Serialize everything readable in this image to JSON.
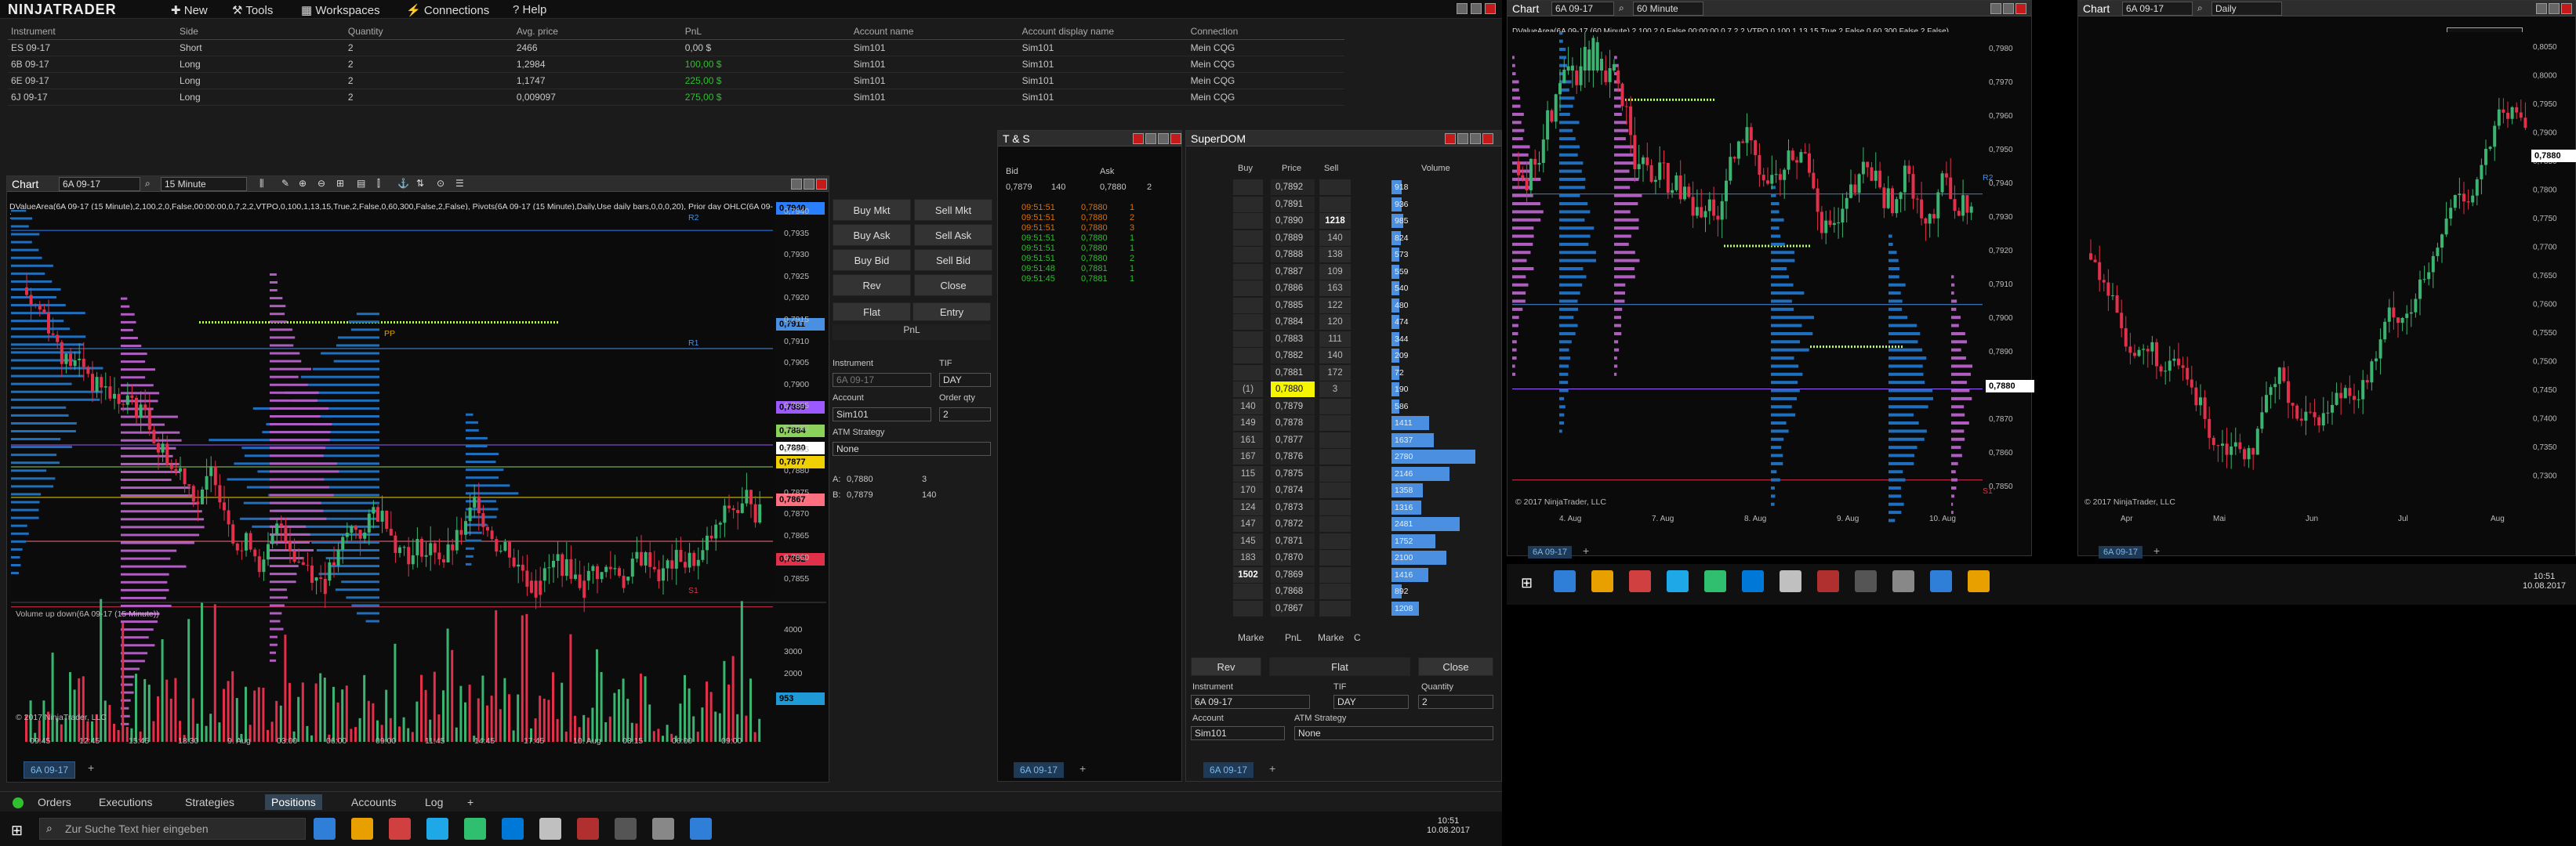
{
  "app": {
    "logo_text": "NINJATRADER",
    "menu": [
      "New",
      "Tools",
      "Workspaces",
      "Connections",
      "Help"
    ]
  },
  "positions": {
    "headers": [
      "Instrument",
      "Side",
      "Quantity",
      "Avg. price",
      "PnL",
      "Account name",
      "Account display name",
      "Connection"
    ],
    "rows": [
      [
        "ES 09-17",
        "Short",
        "2",
        "2466",
        "0,00 $",
        "Sim101",
        "Sim101",
        "Mein CQG"
      ],
      [
        "6B 09-17",
        "Long",
        "2",
        "1,2984",
        "100,00 $",
        "Sim101",
        "Sim101",
        "Mein CQG"
      ],
      [
        "6E 09-17",
        "Long",
        "2",
        "1,1747",
        "225,00 $",
        "Sim101",
        "Sim101",
        "Mein CQG"
      ],
      [
        "6J 09-17",
        "Long",
        "2",
        "0,009097",
        "275,00 $",
        "Sim101",
        "Sim101",
        "Mein CQG"
      ]
    ]
  },
  "chart1": {
    "title": "Chart",
    "instrument": "6A 09-17",
    "interval": "15 Minute",
    "indicator_text": "DValueArea(6A 09-17 (15 Minute),2,100,2,0,False,00:00:00,0,7,2,2,VTPO,0,100,1,13,15,True,2,False,0,60,300,False,2,False), Pivots(6A 09-17 (15 Minute),Daily,Use daily bars,0,0,0,20), Prior day OHLC(6A 09-17 (15 Minute))",
    "yticks": [
      "0,7940",
      "0,7935",
      "0,7930",
      "0,7925",
      "0,7920",
      "0,7915",
      "0,7910",
      "0,7905",
      "0,7900",
      "0,7895",
      "0,7890",
      "0,7885",
      "0,7880",
      "0,7875",
      "0,7870",
      "0,7865",
      "0,7860",
      "0,7855"
    ],
    "price_tags": [
      {
        "label": "0,7940",
        "color": "#2a7fff"
      },
      {
        "label": "0,7911",
        "color": "#4a90e2"
      },
      {
        "label": "0,7889",
        "color": "#9b59ff"
      },
      {
        "label": "0,7884",
        "color": "#8bd25a"
      },
      {
        "label": "0,7880",
        "color": "#ffffff"
      },
      {
        "label": "0,7877",
        "color": "#f0d000"
      },
      {
        "label": "0,7867",
        "color": "#ff6f7f"
      },
      {
        "label": "0,7852",
        "color": "#e0304a"
      }
    ],
    "pivot_labels": {
      "r2": "R2",
      "r1": "R1",
      "pp": "PP",
      "s1": "S1"
    },
    "xticks": [
      "09:45",
      "12:45",
      "15:45",
      "18:30",
      "9. Aug",
      "03:00",
      "06:00",
      "09:00",
      "11:45",
      "14:45",
      "17:45",
      "10. Aug",
      "03:15",
      "06:00",
      "09:00"
    ],
    "volume_label": "Volume up down(6A 09-17 (15 Minute))",
    "volume_ticks": [
      "4000",
      "3000",
      "2000",
      "1000"
    ],
    "volume_tag": "953",
    "copyright": "© 2017 NinjaTrader, LLC",
    "tab_label": "6A 09-17"
  },
  "chart_data": [
    {
      "type": "candlestick",
      "title": "",
      "instrument": "6A 09-17",
      "interval": "15 Minute",
      "ylim": [
        0.7855,
        0.794
      ],
      "last": 0.788,
      "note_levels": [
        0.7911,
        0.7889,
        0.7884,
        0.788,
        0.7877,
        0.7867,
        0.7852
      ]
    },
    {
      "type": "candlestick",
      "instrument": "6A 09-17",
      "interval": "60 Minute",
      "ylim": [
        0.785,
        0.798
      ],
      "last": 0.788
    },
    {
      "type": "candlestick",
      "instrument": "6A 09-17",
      "interval": "Daily",
      "ylim": [
        0.73,
        0.805
      ],
      "last": 0.788
    }
  ],
  "order": {
    "buttons": [
      [
        "Buy Mkt",
        "Sell Mkt"
      ],
      [
        "Buy Ask",
        "Sell Ask"
      ],
      [
        "Buy Bid",
        "Sell Bid"
      ],
      [
        "Rev",
        "Close"
      ]
    ],
    "flat": "Flat",
    "entry": "Entry",
    "pnl": "PnL",
    "instrument_label": "Instrument",
    "instrument_value": "6A 09-17",
    "tif_label": "TIF",
    "tif_value": "DAY",
    "account_label": "Account",
    "account_value": "Sim101",
    "qty_label": "Order qty",
    "qty_value": "2",
    "atm_label": "ATM Strategy",
    "atm_value": "None",
    "ask_label": "A:",
    "ask_price": "0,7880",
    "ask_size": "3",
    "bid_label": "B:",
    "bid_price": "0,7879",
    "bid_size": "140"
  },
  "ts": {
    "title": "T & S",
    "bid_label": "Bid",
    "ask_label": "Ask",
    "bid": "0,7879",
    "bidsz": "140",
    "ask": "0,7880",
    "asksz": "2",
    "rows": [
      [
        "09:51:51",
        "0,7880",
        "1",
        "#e07000"
      ],
      [
        "09:51:51",
        "0,7880",
        "2",
        "#e07000"
      ],
      [
        "09:51:51",
        "0,7880",
        "3",
        "#e07000"
      ],
      [
        "09:51:51",
        "0,7880",
        "1",
        "#2fbf2f"
      ],
      [
        "09:51:51",
        "0,7880",
        "1",
        "#2fbf2f"
      ],
      [
        "09:51:51",
        "0,7880",
        "2",
        "#2fbf2f"
      ],
      [
        "09:51:48",
        "0,7881",
        "1",
        "#2fbf2f"
      ],
      [
        "09:51:45",
        "0,7881",
        "1",
        "#2fbf2f"
      ]
    ],
    "tab": "6A 09-17"
  },
  "dom": {
    "title": "SuperDOM",
    "headers": [
      "Buy",
      "Price",
      "Sell",
      "Volume"
    ],
    "rows": [
      [
        "",
        "0,7892",
        "",
        "918",
        0.1
      ],
      [
        "",
        "0,7891",
        "",
        "936",
        0.1
      ],
      [
        "",
        "0,7890",
        "1218",
        "985",
        0.11
      ],
      [
        "",
        "0,7889",
        "140",
        "824",
        0.09
      ],
      [
        "",
        "0,7888",
        "138",
        "573",
        0.07
      ],
      [
        "",
        "0,7887",
        "109",
        "559",
        0.06
      ],
      [
        "",
        "0,7886",
        "163",
        "540",
        0.06
      ],
      [
        "",
        "0,7885",
        "122",
        "480",
        0.05
      ],
      [
        "",
        "0,7884",
        "120",
        "474",
        0.05
      ],
      [
        "",
        "0,7883",
        "111",
        "344",
        0.04
      ],
      [
        "",
        "0,7882",
        "140",
        "209",
        0.02
      ],
      [
        "",
        "0,7881",
        "172",
        "72",
        0.01
      ],
      [
        "(1)",
        "0,7880",
        "3",
        "190",
        0.02
      ],
      [
        "140",
        "0,7879",
        "",
        "586",
        0.07
      ],
      [
        "149",
        "0,7878",
        "",
        "1411",
        0.36
      ],
      [
        "161",
        "0,7877",
        "",
        "1637",
        0.4
      ],
      [
        "167",
        "0,7876",
        "",
        "2780",
        0.8
      ],
      [
        "115",
        "0,7875",
        "",
        "2146",
        0.55
      ],
      [
        "170",
        "0,7874",
        "",
        "1358",
        0.3
      ],
      [
        "124",
        "0,7873",
        "",
        "1316",
        0.28
      ],
      [
        "147",
        "0,7872",
        "",
        "2481",
        0.65
      ],
      [
        "145",
        "0,7871",
        "",
        "1752",
        0.42
      ],
      [
        "183",
        "0,7870",
        "",
        "2100",
        0.52
      ],
      [
        "1502",
        "0,7869",
        "",
        "1416",
        0.35
      ],
      [
        "",
        "0,7868",
        "",
        "892",
        0.1
      ],
      [
        "",
        "0,7867",
        "",
        "1208",
        0.26
      ]
    ],
    "bottom": [
      "Marke",
      "PnL",
      "Marke",
      "C"
    ],
    "rev": "Rev",
    "flat": "Flat",
    "close": "Close",
    "instrument_label": "Instrument",
    "instrument_value": "6A 09-17",
    "tif_label": "TIF",
    "tif_value": "DAY",
    "qty_label": "Quantity",
    "qty_value": "2",
    "account_label": "Account",
    "account_value": "Sim101",
    "atm_label": "ATM Strategy",
    "atm_value": "None",
    "tab": "6A 09-17"
  },
  "chart2": {
    "title": "Chart",
    "instrument": "6A 09-17",
    "interval": "60 Minute",
    "indicator_text": "DValueArea(6A 09-17 (60 Minute),2,100,2,0,False,00:00:00,0,7,2,2,VTPO,0,100,1,13,15,True,2,False,0,60,300,False,2,False), Prior day OHLC(6A 09-17 (60 Minute)), Pivots(6A 09-17 (60 Minute),Daily,Use daily bars,0,0,0,20)",
    "yticks": [
      "0,7980",
      "0,7970",
      "0,7960",
      "0,7950",
      "0,7940",
      "0,7930",
      "0,7920",
      "0,7910",
      "0,7900",
      "0,7890",
      "0,7880",
      "0,7870",
      "0,7860",
      "0,7850"
    ],
    "xticks": [
      "4. Aug",
      "7. Aug",
      "8. Aug",
      "9. Aug",
      "10. Aug"
    ],
    "pivot_labels": {
      "r2": "R2",
      "s1": "S1"
    },
    "tag": "0,7880",
    "copyright": "© 2017 NinjaTrader, LLC",
    "tab": "6A 09-17"
  },
  "chart3": {
    "title": "Chart",
    "instrument": "6A 09-17",
    "interval": "Daily",
    "data_box": "Show Data Box",
    "yticks": [
      "0,8050",
      "0,8000",
      "0,7950",
      "0,7900",
      "0,7850",
      "0,7800",
      "0,7750",
      "0,7700",
      "0,7650",
      "0,7600",
      "0,7550",
      "0,7500",
      "0,7450",
      "0,7400",
      "0,7350",
      "0,7300"
    ],
    "xticks": [
      "Apr",
      "Mai",
      "Jun",
      "Jul",
      "Aug"
    ],
    "tag": "0,7880",
    "copyright": "© 2017 NinjaTrader, LLC",
    "tab": "6A 09-17"
  },
  "bottom_tabs": [
    "Orders",
    "Executions",
    "Strategies",
    "Positions",
    "Accounts",
    "Log"
  ],
  "taskbar": {
    "search": "Zur Suche Text hier eingeben",
    "time": "10:51",
    "date": "10.08.2017"
  },
  "colors": {
    "bull": "#3cb371",
    "bear": "#e0304a",
    "profile": "#1f6fbf",
    "profile2": "#b05dc0"
  }
}
